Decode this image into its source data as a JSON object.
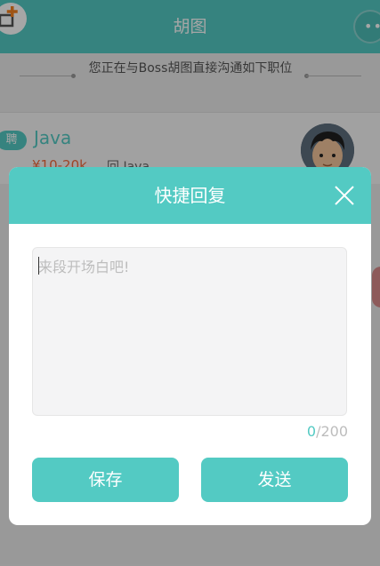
{
  "header": {
    "title": "胡图",
    "menu_icon": "more-dots-icon",
    "left_icon": "add-icon"
  },
  "notice": {
    "text": "您正在与Boss胡图直接沟通如下职位"
  },
  "job": {
    "tag": "聘",
    "title": "Java",
    "salary": "¥10-20k",
    "sub": "回 Java"
  },
  "dialog": {
    "title": "快捷回复",
    "placeholder": "来段开场白吧!",
    "counter_current": "0",
    "counter_max": "/200",
    "save_label": "保存",
    "send_label": "发送"
  },
  "colors": {
    "accent": "#53cac3",
    "salary": "#f26a3c"
  }
}
